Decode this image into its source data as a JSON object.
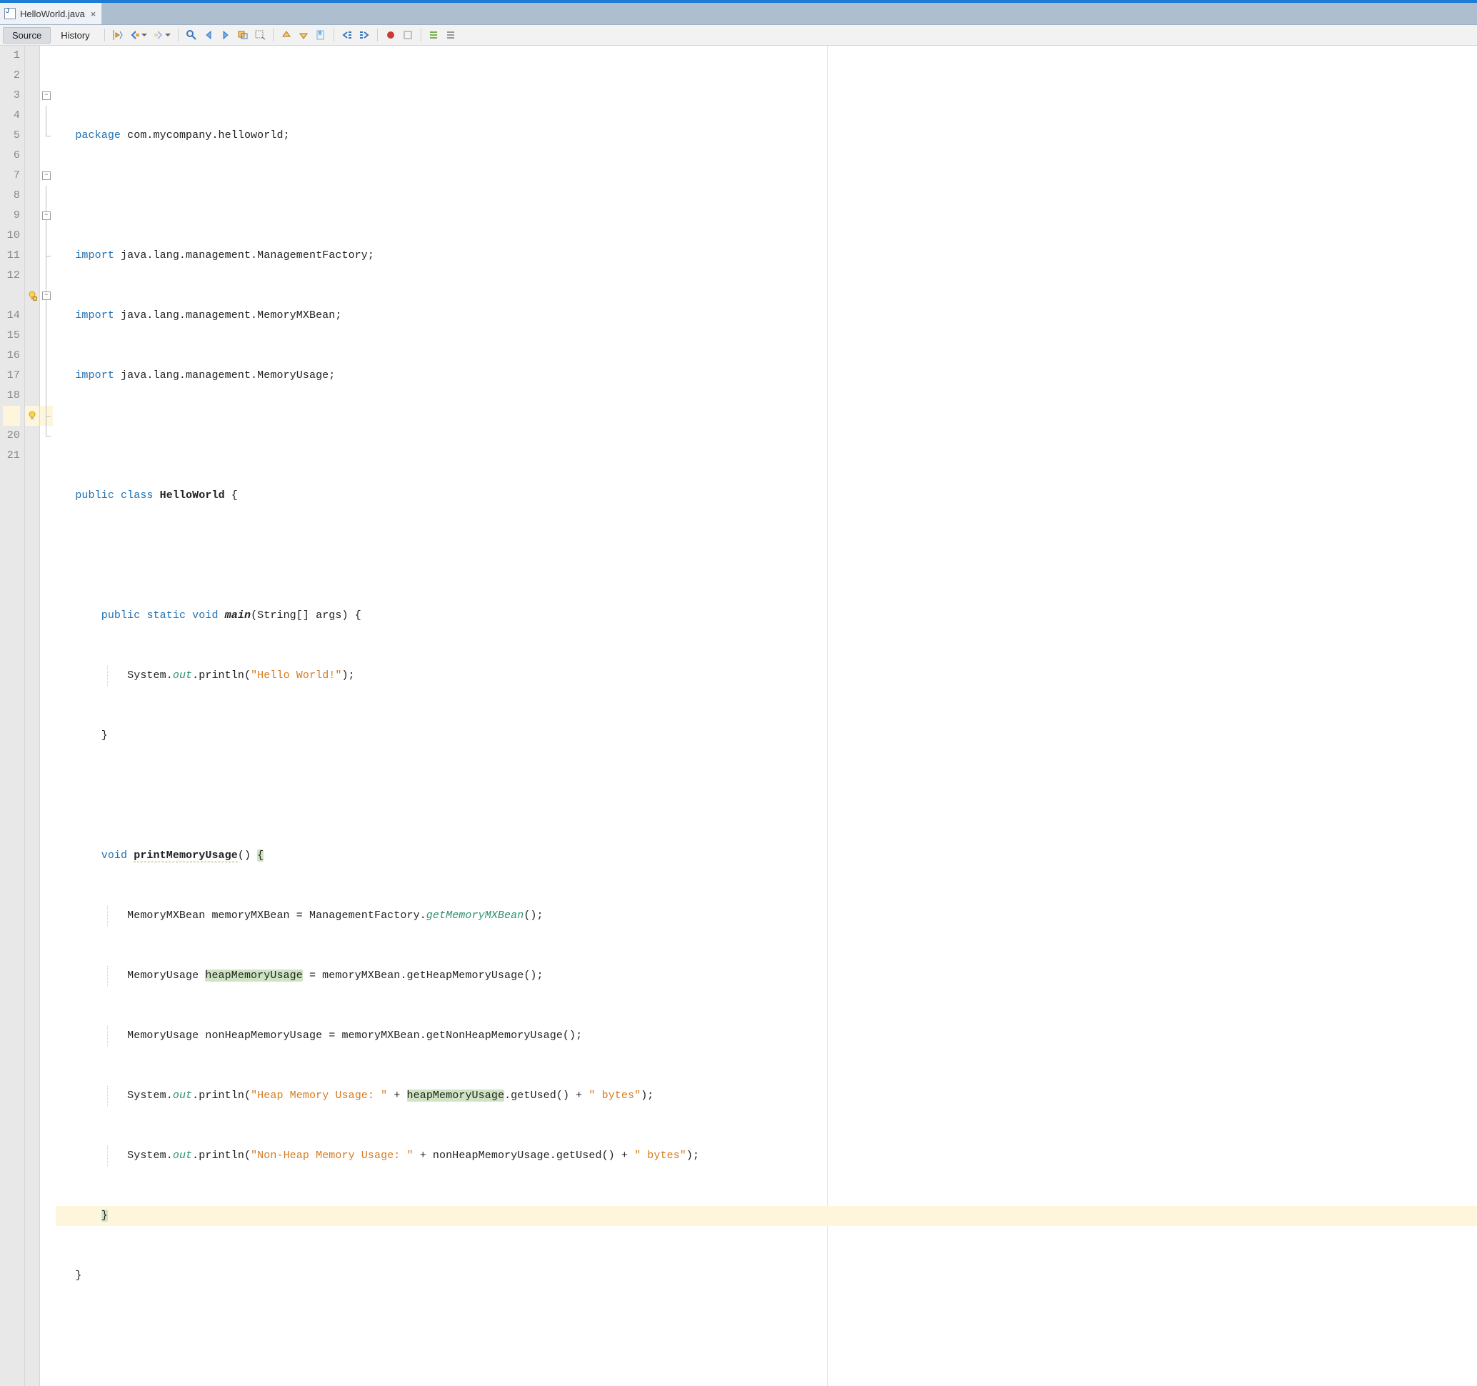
{
  "tab": {
    "filename": "HelloWorld.java"
  },
  "modes": {
    "source": "Source",
    "history": "History"
  },
  "code": {
    "package_kw": "package",
    "package_path": " com.mycompany.helloworld;",
    "import_kw": "import",
    "imp1": " java.lang.management.ManagementFactory;",
    "imp2": " java.lang.management.MemoryMXBean;",
    "imp3": " java.lang.management.MemoryUsage;",
    "public_kw": "public",
    "class_kw": "class",
    "class_name": "HelloWorld",
    "static_kw": "static",
    "void_kw": "void",
    "main_name": "main",
    "main_args": "(String[] args) {",
    "sys": "System.",
    "out": "out",
    "println_hello": ".println(",
    "hello_str": "\"Hello World!\"",
    "println_close": ");",
    "brace_close": "}",
    "method2_name": "printMemoryUsage",
    "method2_sig": "() ",
    "brace_open_hl": "{",
    "l14_a": "MemoryMXBean memoryMXBean = ManagementFactory.",
    "l14_b": "getMemoryMXBean",
    "l14_c": "();",
    "l15_a": "MemoryUsage ",
    "l15_b": "heapMemoryUsage",
    "l15_c": " = memoryMXBean.getHeapMemoryUsage();",
    "l16": "MemoryUsage nonHeapMemoryUsage = memoryMXBean.getNonHeapMemoryUsage();",
    "l17_a": ".println(",
    "l17_str1": "\"Heap Memory Usage: \"",
    "l17_b": " + ",
    "l17_c": "heapMemoryUsage",
    "l17_d": ".getUsed() + ",
    "l17_str2": "\" bytes\"",
    "l18_str1": "\"Non-Heap Memory Usage: \"",
    "l18_b": " + nonHeapMemoryUsage.getUsed() + ",
    "l18_str2": "\" bytes\""
  },
  "lines": [
    "1",
    "2",
    "3",
    "4",
    "5",
    "6",
    "7",
    "8",
    "9",
    "10",
    "11",
    "12",
    "",
    "14",
    "15",
    "16",
    "17",
    "18",
    "",
    "20",
    "21"
  ]
}
